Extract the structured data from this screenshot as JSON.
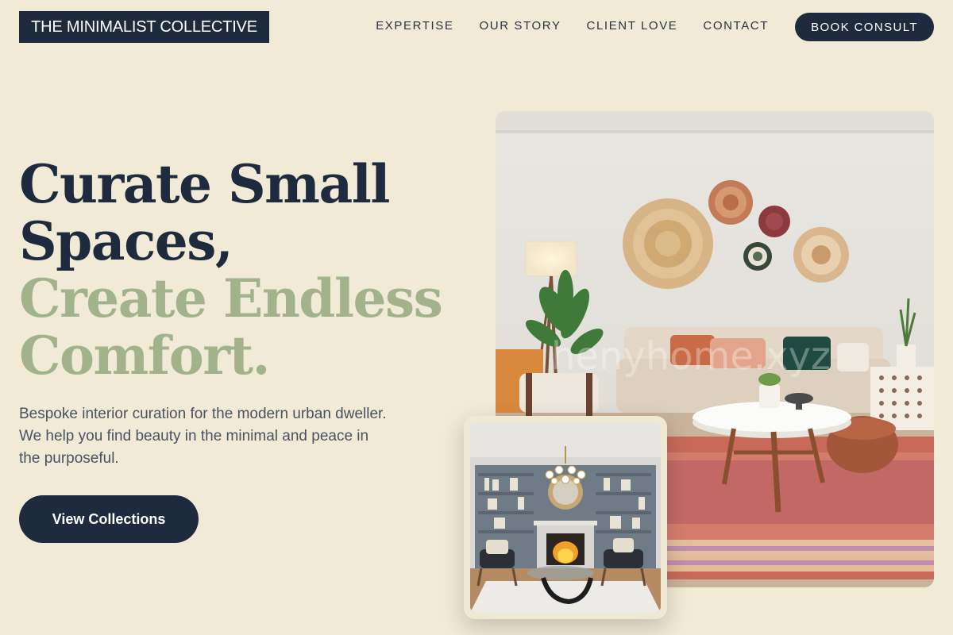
{
  "brand": {
    "logo_text": "THE MINIMALIST COLLECTIVE"
  },
  "nav": {
    "items": [
      "EXPERTISE",
      "OUR STORY",
      "CLIENT LOVE",
      "CONTACT"
    ],
    "cta_label": "BOOK CONSULT"
  },
  "hero": {
    "headline_dark_1": "Curate Small",
    "headline_dark_2": "Spaces,",
    "headline_accent_1": "Create Endless",
    "headline_accent_2": "Comfort.",
    "subtitle": "Bespoke interior curation for the modern urban dweller. We help you find beauty in the minimal and peace in the purposeful.",
    "button_label": "View Collections"
  },
  "images": {
    "main": "living-room-photo",
    "inset": "fireplace-living-room-photo",
    "watermark": "henyhome.xyz"
  },
  "colors": {
    "background": "#f0ead6",
    "navy": "#1e2a3d",
    "sage": "#a2b38c",
    "body_text": "#4a5262"
  }
}
